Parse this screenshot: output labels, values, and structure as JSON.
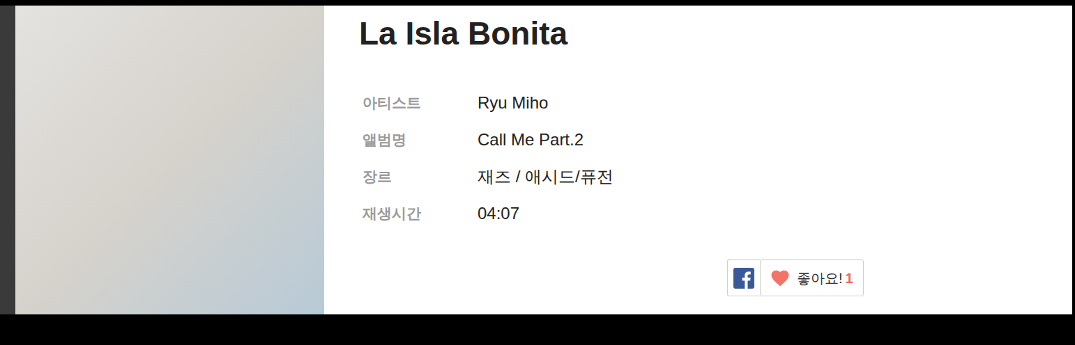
{
  "track": {
    "title": "La Isla Bonita"
  },
  "fields": [
    {
      "label": "아티스트",
      "value": "Ryu Miho"
    },
    {
      "label": "앨범명",
      "value": "Call Me Part.2"
    },
    {
      "label": "장르",
      "value": "재즈 / 애시드/퓨전"
    },
    {
      "label": "재생시간",
      "value": "04:07"
    }
  ],
  "like": {
    "label": "좋아요!",
    "count": "1"
  }
}
